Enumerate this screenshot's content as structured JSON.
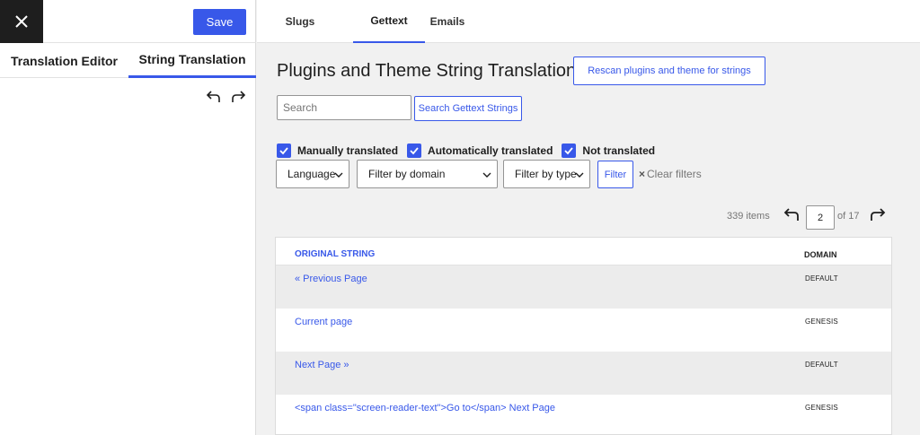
{
  "sidebar": {
    "save_label": "Save",
    "tabs": [
      "Translation Editor",
      "String Translation"
    ]
  },
  "top_tabs": [
    "Slugs",
    "Gettext",
    "Emails"
  ],
  "main": {
    "title": "Plugins and Theme String Translation",
    "rescan_label": "Rescan plugins and theme for strings",
    "search_placeholder": "Search",
    "search_button": "Search Gettext Strings",
    "checkboxes": [
      "Manually translated",
      "Automatically translated",
      "Not translated"
    ],
    "filters": {
      "language": "Language",
      "domain": "Filter by domain",
      "type": "Filter by type",
      "filter_button": "Filter",
      "clear_label": "Clear filters"
    },
    "pagination": {
      "items": "339 items",
      "page": "2",
      "of_total": "of 17"
    },
    "table": {
      "headers": [
        "ORIGINAL STRING",
        "DOMAIN"
      ],
      "rows": [
        {
          "string": "« Previous Page",
          "domain": "DEFAULT"
        },
        {
          "string": "Current page",
          "domain": "GENESIS"
        },
        {
          "string": "Next Page »",
          "domain": "DEFAULT"
        },
        {
          "string": "<span class=\"screen-reader-text\">Go to</span> Next Page",
          "domain": "GENESIS"
        }
      ]
    }
  },
  "colors": {
    "accent": "#3858e9",
    "dark": "#1e1e1e"
  }
}
